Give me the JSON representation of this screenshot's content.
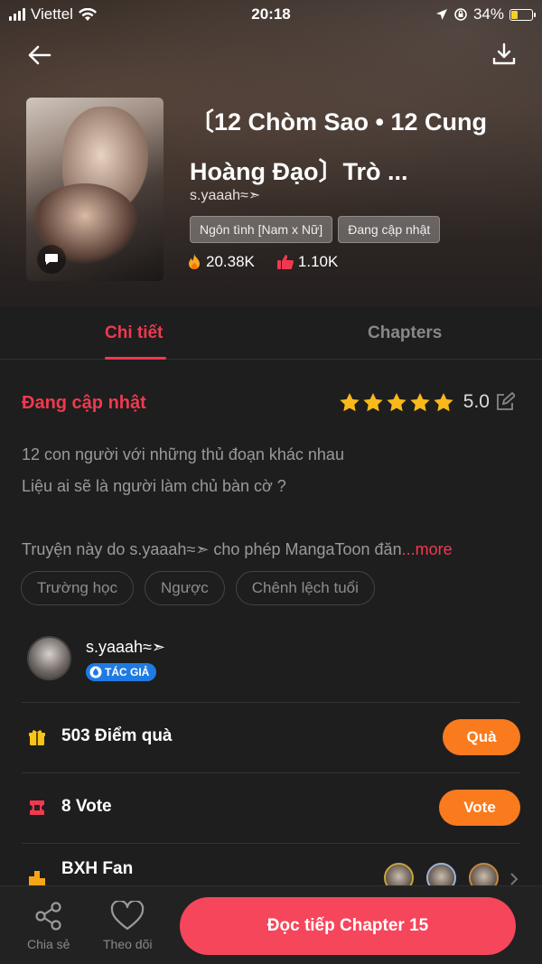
{
  "status_bar": {
    "carrier": "Viettel",
    "time": "20:18",
    "battery": "34%"
  },
  "book": {
    "title": "〔12 Chòm Sao • 12 Cung Hoàng Đạo〕Trò ...",
    "author": "s.yaaah≈➣",
    "genres": [
      "Ngôn tình [Nam x Nữ]",
      "Đang cập nhật"
    ],
    "views": "20.38K",
    "likes": "1.10K"
  },
  "tabs": [
    "Chi tiết",
    "Chapters"
  ],
  "details": {
    "status": "Đang cập nhật",
    "rating": "5.0",
    "description_lines": [
      "12 con người với những thủ đoạn khác nhau",
      "Liệu ai sẽ là người làm chủ bàn cờ ?",
      "",
      "Truyện này do s.yaaah≈➣ cho phép MangaToon đăn"
    ],
    "more_label": "...more",
    "tags": [
      "Trường học",
      "Ngược",
      "Chênh lệch tuổi"
    ]
  },
  "author_card": {
    "name": "s.yaaah≈➣",
    "badge": "TÁC GIẢ"
  },
  "gift": {
    "label": "503 Điểm quà",
    "button": "Quà"
  },
  "vote": {
    "label": "8 Vote",
    "button": "Vote"
  },
  "fan_rank": {
    "label": "BXH Fan"
  },
  "bottom_bar": {
    "share": "Chia sẻ",
    "follow": "Theo dõi",
    "continue": "Đọc tiếp Chapter 15"
  },
  "colors": {
    "accent": "#f0394f",
    "orange": "#fa7a1e",
    "bg": "#1e1e1e"
  }
}
